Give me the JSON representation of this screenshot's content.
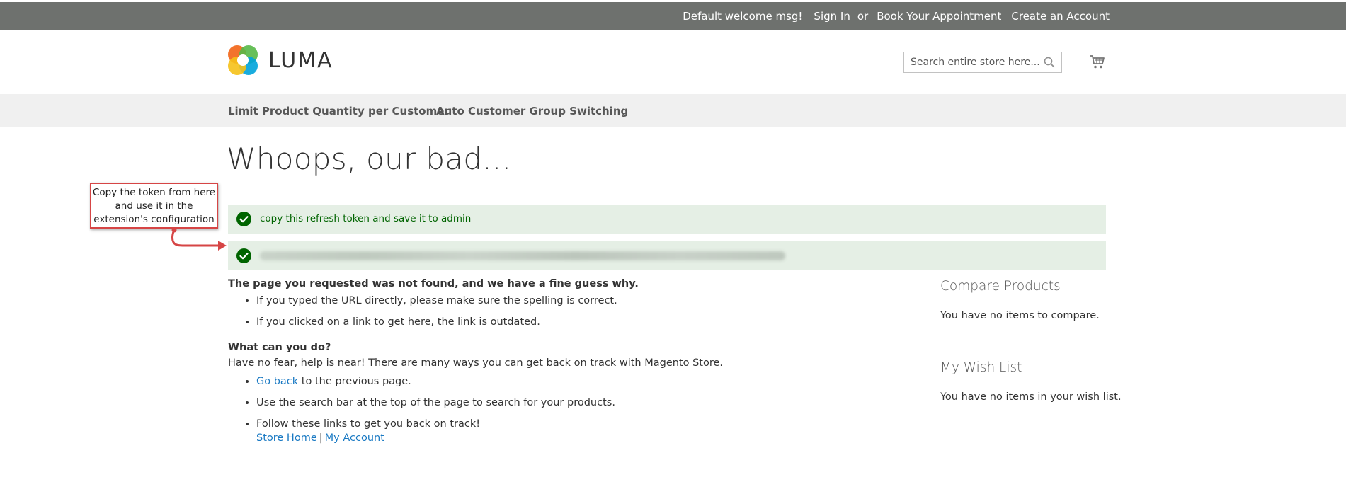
{
  "top_bar": {
    "welcome": "Default welcome msg!",
    "sign_in": "Sign In",
    "or": "or",
    "book": "Book Your Appointment",
    "create_account": "Create an Account"
  },
  "header": {
    "logo_text": "LUMA",
    "search_placeholder": "Search entire store here...",
    "cart_icon": "cart-icon"
  },
  "nav": {
    "items": [
      {
        "label": "Limit Product Quantity per Customer"
      },
      {
        "label": "Auto Customer Group Switching"
      }
    ]
  },
  "page_title": "Whoops, our bad...",
  "messages": [
    {
      "text": "copy this refresh token and save it to admin"
    },
    {
      "text": ""
    }
  ],
  "callout": {
    "line1": "Copy the token from here",
    "line2": "and use it in the",
    "line3": "extension's configuration"
  },
  "not_found": {
    "heading": "The page you requested was not found, and we have a fine guess why.",
    "reasons": [
      "If you typed the URL directly, please make sure the spelling is correct.",
      "If you clicked on a link to get here, the link is outdated."
    ],
    "what_heading": "What can you do?",
    "help_text": "Have no fear, help is near! There are many ways you can get back on track with Magento Store.",
    "go_back_link": "Go back",
    "go_back_rest": " to the previous page.",
    "search_tip": "Use the search bar at the top of the page to search for your products.",
    "follow_text": "Follow these links to get you back on track!",
    "store_home": "Store Home",
    "separator": "|",
    "my_account": "My Account"
  },
  "sidebar": {
    "compare_title": "Compare Products",
    "compare_text": "You have no items to compare.",
    "wishlist_title": "My Wish List",
    "wishlist_text": "You have no items in your wish list."
  },
  "colors": {
    "top_bar": "#6e716e",
    "nav_bar": "#f0f0f0",
    "success_bg": "#e5efe5",
    "success_text": "#006400",
    "link": "#1979c3",
    "callout_border": "#d64545"
  }
}
